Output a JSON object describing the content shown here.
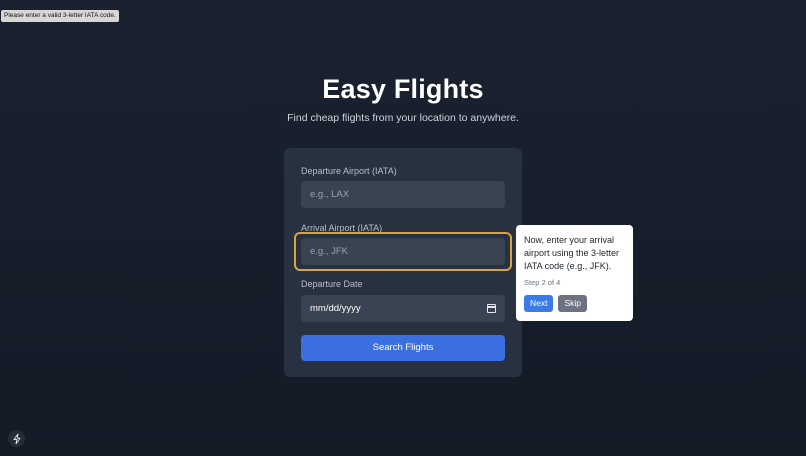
{
  "validation_tooltip": "Please enter a valid 3-letter IATA code.",
  "header": {
    "title": "Easy Flights",
    "subtitle": "Find cheap flights from your location to anywhere."
  },
  "form": {
    "departure": {
      "label": "Departure Airport (IATA)",
      "placeholder": "e.g., LAX",
      "value": ""
    },
    "arrival": {
      "label": "Arrival Airport (IATA)",
      "placeholder": "e.g., JFK",
      "value": ""
    },
    "date": {
      "label": "Departure Date",
      "value": "mm/dd/yyyy"
    },
    "search_label": "Search Flights"
  },
  "tour": {
    "text": "Now, enter your arrival airport using the 3-letter IATA code (e.g., JFK).",
    "step": "Step 2 of 4",
    "next_label": "Next",
    "skip_label": "Skip"
  },
  "icons": {
    "calendar": "calendar-icon",
    "bolt": "bolt-icon"
  },
  "colors": {
    "primary": "#3b6fe0",
    "highlight": "#d9a243",
    "card": "#283140"
  }
}
